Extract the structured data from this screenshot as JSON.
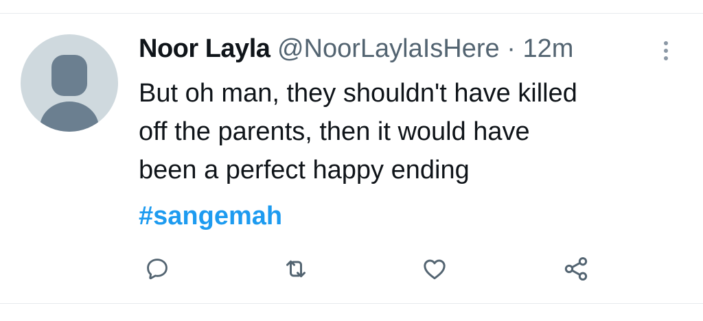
{
  "author": {
    "name": "Noor Layla",
    "handle": "@NoorLaylaIsHere",
    "separator": "·",
    "time": "12m"
  },
  "tweet": {
    "lines": [
      "But oh man, they shouldn't have killed",
      "off the parents, then it would have",
      "been a perfect happy ending"
    ],
    "hashtag": "#sangemah"
  },
  "icons": {
    "more": "more-vertical-icon",
    "reply": "reply-icon",
    "retweet": "retweet-icon",
    "like": "heart-icon",
    "share": "share-icon"
  },
  "colors": {
    "text": "#0f1419",
    "secondary": "#536471",
    "link": "#1d9bf0",
    "avatar_bg": "#cfd9de",
    "avatar_fg": "#6b7f90",
    "divider": "#e7eaed"
  }
}
